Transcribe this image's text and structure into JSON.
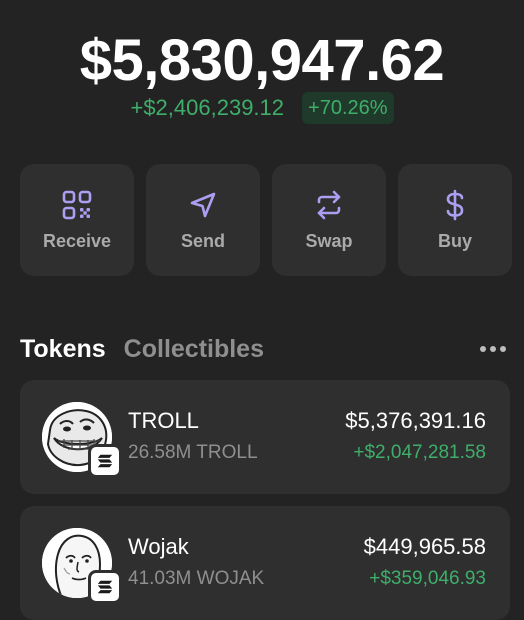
{
  "portfolio": {
    "balance": "$5,830,947.62",
    "change_amount": "+$2,406,239.12",
    "change_percent": "+70.26%"
  },
  "actions": [
    {
      "label": "Receive",
      "icon": "qr-code-icon"
    },
    {
      "label": "Send",
      "icon": "send-icon"
    },
    {
      "label": "Swap",
      "icon": "swap-icon"
    },
    {
      "label": "Buy",
      "icon": "dollar-icon"
    }
  ],
  "tabs": {
    "tokens": "Tokens",
    "collectibles": "Collectibles"
  },
  "tokens": [
    {
      "name": "TROLL",
      "amount": "26.58M TROLL",
      "value": "$5,376,391.16",
      "change": "+$2,047,281.58"
    },
    {
      "name": "Wojak",
      "amount": "41.03M WOJAK",
      "value": "$449,965.58",
      "change": "+$359,046.93"
    }
  ],
  "colors": {
    "background": "#232323",
    "card": "#2f2f2f",
    "accent": "#ab9ff2",
    "positive": "#3fae6a"
  }
}
